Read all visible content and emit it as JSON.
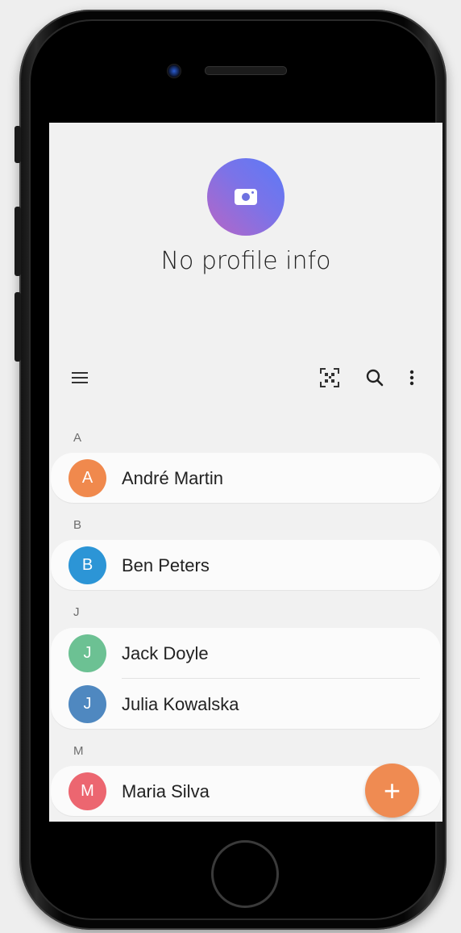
{
  "profile": {
    "name": "No profile info",
    "avatar_icon": "camera-icon",
    "avatar_gradient": [
      "#5b7af7",
      "#b865c5"
    ]
  },
  "toolbar": {
    "icons": [
      "menu-icon",
      "qr-code-icon",
      "search-icon",
      "more-options-icon"
    ]
  },
  "sections": [
    {
      "letter": "A",
      "contacts": [
        {
          "name": "André Martin",
          "initial": "A",
          "color": "#f0894d"
        }
      ]
    },
    {
      "letter": "B",
      "contacts": [
        {
          "name": "Ben Peters",
          "initial": "B",
          "color": "#2c95d6"
        }
      ]
    },
    {
      "letter": "J",
      "contacts": [
        {
          "name": "Jack Doyle",
          "initial": "J",
          "color": "#6cc193"
        },
        {
          "name": "Julia Kowalska",
          "initial": "J",
          "color": "#4f88c0"
        }
      ]
    },
    {
      "letter": "M",
      "contacts": [
        {
          "name": "Maria Silva",
          "initial": "M",
          "color": "#ec6670"
        }
      ]
    }
  ],
  "fab": {
    "label": "+",
    "color": "#ef8b52"
  }
}
